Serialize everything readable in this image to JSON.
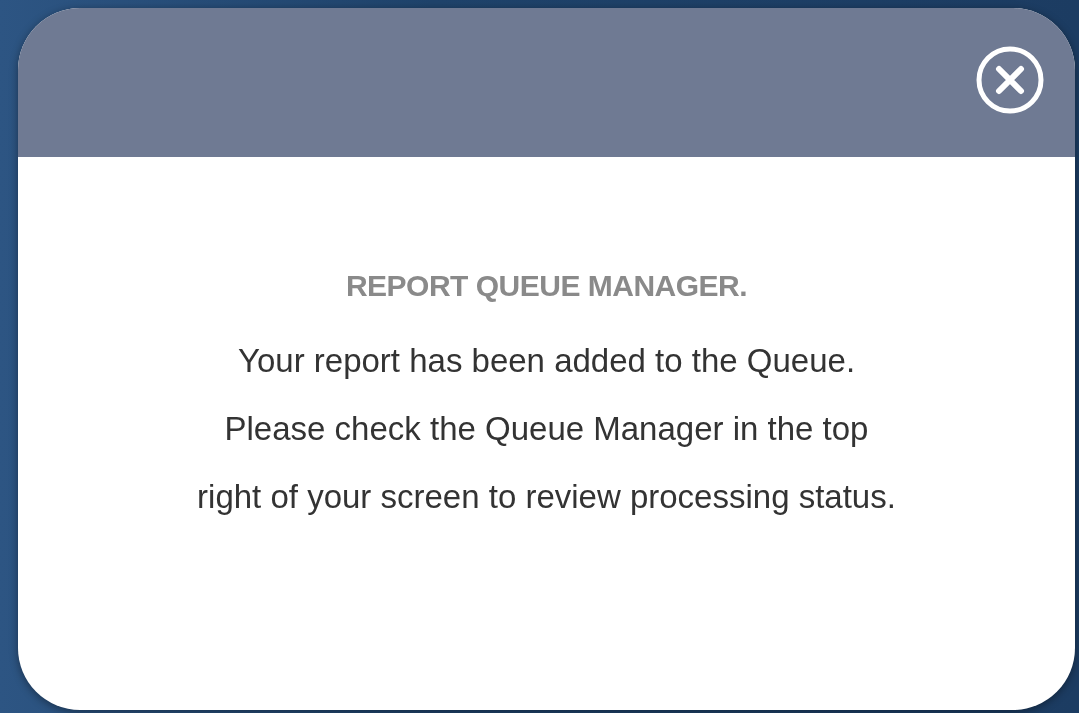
{
  "dialog": {
    "title": "REPORT QUEUE MANAGER.",
    "message_lines": [
      "Your report has been added to the Queue.",
      "Please check the Queue Manager in the top",
      "right of your screen to review processing status."
    ]
  }
}
